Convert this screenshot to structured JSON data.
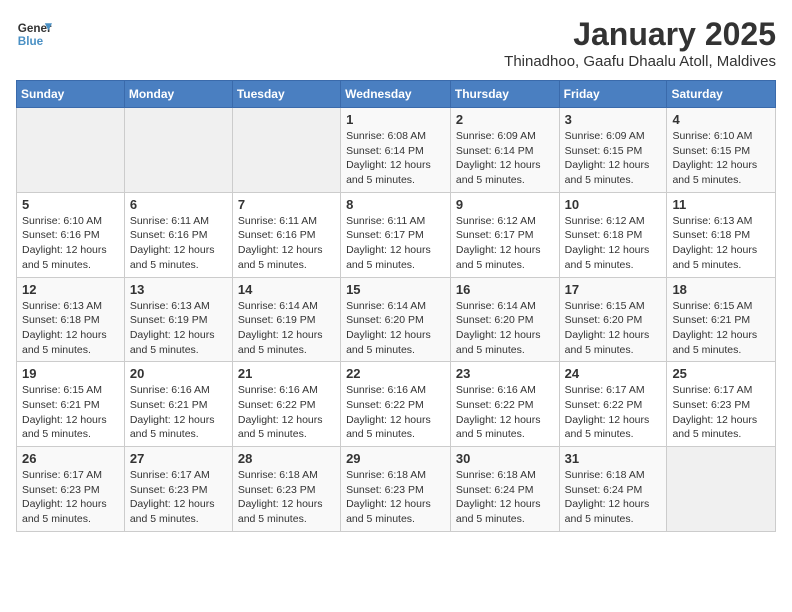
{
  "logo": {
    "line1": "General",
    "line2": "Blue"
  },
  "title": "January 2025",
  "subtitle": "Thinadhoo, Gaafu Dhaalu Atoll, Maldives",
  "weekdays": [
    "Sunday",
    "Monday",
    "Tuesday",
    "Wednesday",
    "Thursday",
    "Friday",
    "Saturday"
  ],
  "weeks": [
    [
      {
        "day": "",
        "info": ""
      },
      {
        "day": "",
        "info": ""
      },
      {
        "day": "",
        "info": ""
      },
      {
        "day": "1",
        "info": "Sunrise: 6:08 AM\nSunset: 6:14 PM\nDaylight: 12 hours\nand 5 minutes."
      },
      {
        "day": "2",
        "info": "Sunrise: 6:09 AM\nSunset: 6:14 PM\nDaylight: 12 hours\nand 5 minutes."
      },
      {
        "day": "3",
        "info": "Sunrise: 6:09 AM\nSunset: 6:15 PM\nDaylight: 12 hours\nand 5 minutes."
      },
      {
        "day": "4",
        "info": "Sunrise: 6:10 AM\nSunset: 6:15 PM\nDaylight: 12 hours\nand 5 minutes."
      }
    ],
    [
      {
        "day": "5",
        "info": "Sunrise: 6:10 AM\nSunset: 6:16 PM\nDaylight: 12 hours\nand 5 minutes."
      },
      {
        "day": "6",
        "info": "Sunrise: 6:11 AM\nSunset: 6:16 PM\nDaylight: 12 hours\nand 5 minutes."
      },
      {
        "day": "7",
        "info": "Sunrise: 6:11 AM\nSunset: 6:16 PM\nDaylight: 12 hours\nand 5 minutes."
      },
      {
        "day": "8",
        "info": "Sunrise: 6:11 AM\nSunset: 6:17 PM\nDaylight: 12 hours\nand 5 minutes."
      },
      {
        "day": "9",
        "info": "Sunrise: 6:12 AM\nSunset: 6:17 PM\nDaylight: 12 hours\nand 5 minutes."
      },
      {
        "day": "10",
        "info": "Sunrise: 6:12 AM\nSunset: 6:18 PM\nDaylight: 12 hours\nand 5 minutes."
      },
      {
        "day": "11",
        "info": "Sunrise: 6:13 AM\nSunset: 6:18 PM\nDaylight: 12 hours\nand 5 minutes."
      }
    ],
    [
      {
        "day": "12",
        "info": "Sunrise: 6:13 AM\nSunset: 6:18 PM\nDaylight: 12 hours\nand 5 minutes."
      },
      {
        "day": "13",
        "info": "Sunrise: 6:13 AM\nSunset: 6:19 PM\nDaylight: 12 hours\nand 5 minutes."
      },
      {
        "day": "14",
        "info": "Sunrise: 6:14 AM\nSunset: 6:19 PM\nDaylight: 12 hours\nand 5 minutes."
      },
      {
        "day": "15",
        "info": "Sunrise: 6:14 AM\nSunset: 6:20 PM\nDaylight: 12 hours\nand 5 minutes."
      },
      {
        "day": "16",
        "info": "Sunrise: 6:14 AM\nSunset: 6:20 PM\nDaylight: 12 hours\nand 5 minutes."
      },
      {
        "day": "17",
        "info": "Sunrise: 6:15 AM\nSunset: 6:20 PM\nDaylight: 12 hours\nand 5 minutes."
      },
      {
        "day": "18",
        "info": "Sunrise: 6:15 AM\nSunset: 6:21 PM\nDaylight: 12 hours\nand 5 minutes."
      }
    ],
    [
      {
        "day": "19",
        "info": "Sunrise: 6:15 AM\nSunset: 6:21 PM\nDaylight: 12 hours\nand 5 minutes."
      },
      {
        "day": "20",
        "info": "Sunrise: 6:16 AM\nSunset: 6:21 PM\nDaylight: 12 hours\nand 5 minutes."
      },
      {
        "day": "21",
        "info": "Sunrise: 6:16 AM\nSunset: 6:22 PM\nDaylight: 12 hours\nand 5 minutes."
      },
      {
        "day": "22",
        "info": "Sunrise: 6:16 AM\nSunset: 6:22 PM\nDaylight: 12 hours\nand 5 minutes."
      },
      {
        "day": "23",
        "info": "Sunrise: 6:16 AM\nSunset: 6:22 PM\nDaylight: 12 hours\nand 5 minutes."
      },
      {
        "day": "24",
        "info": "Sunrise: 6:17 AM\nSunset: 6:22 PM\nDaylight: 12 hours\nand 5 minutes."
      },
      {
        "day": "25",
        "info": "Sunrise: 6:17 AM\nSunset: 6:23 PM\nDaylight: 12 hours\nand 5 minutes."
      }
    ],
    [
      {
        "day": "26",
        "info": "Sunrise: 6:17 AM\nSunset: 6:23 PM\nDaylight: 12 hours\nand 5 minutes."
      },
      {
        "day": "27",
        "info": "Sunrise: 6:17 AM\nSunset: 6:23 PM\nDaylight: 12 hours\nand 5 minutes."
      },
      {
        "day": "28",
        "info": "Sunrise: 6:18 AM\nSunset: 6:23 PM\nDaylight: 12 hours\nand 5 minutes."
      },
      {
        "day": "29",
        "info": "Sunrise: 6:18 AM\nSunset: 6:23 PM\nDaylight: 12 hours\nand 5 minutes."
      },
      {
        "day": "30",
        "info": "Sunrise: 6:18 AM\nSunset: 6:24 PM\nDaylight: 12 hours\nand 5 minutes."
      },
      {
        "day": "31",
        "info": "Sunrise: 6:18 AM\nSunset: 6:24 PM\nDaylight: 12 hours\nand 5 minutes."
      },
      {
        "day": "",
        "info": ""
      }
    ]
  ]
}
